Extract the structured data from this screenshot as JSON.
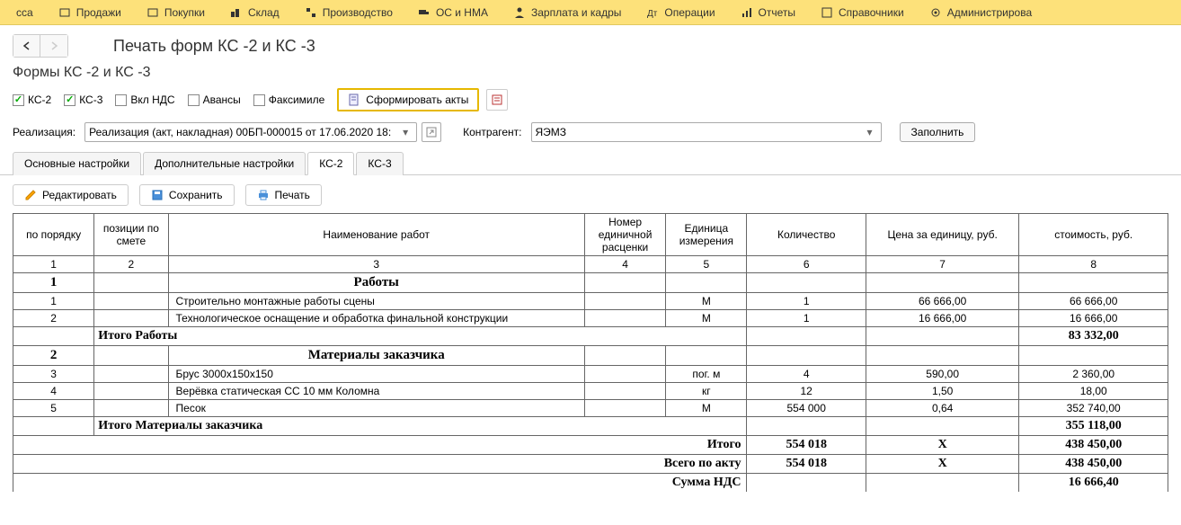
{
  "topmenu": {
    "items": [
      {
        "label": "сса"
      },
      {
        "label": "Продажи"
      },
      {
        "label": "Покупки"
      },
      {
        "label": "Склад"
      },
      {
        "label": "Производство"
      },
      {
        "label": "ОС и НМА"
      },
      {
        "label": "Зарплата и кадры"
      },
      {
        "label": "Операции"
      },
      {
        "label": "Отчеты"
      },
      {
        "label": "Справочники"
      },
      {
        "label": "Администрирова"
      }
    ]
  },
  "title": "Печать форм КС -2 и КС -3",
  "subtitle": "Формы КС -2 и КС -3",
  "checks": {
    "ks2": "КС-2",
    "ks3": "КС-3",
    "vklnds": "Вкл НДС",
    "avansy": "Авансы",
    "faksimile": "Факсимиле"
  },
  "generate_btn": "Сформировать акты",
  "fields": {
    "realiz_label": "Реализация:",
    "realiz_value": "Реализация (акт, накладная) 00БП-000015 от 17.06.2020 18:",
    "kontragent_label": "Контрагент:",
    "kontragent_value": "ЯЭМЗ",
    "fill_btn": "Заполнить"
  },
  "tabs": {
    "t1": "Основные настройки",
    "t2": "Дополнительные настройки",
    "t3": "КС-2",
    "t4": "КС-3"
  },
  "toolbar": {
    "edit": "Редактировать",
    "save": "Сохранить",
    "print": "Печать"
  },
  "table": {
    "headers": {
      "h1": "по порядку",
      "h2": "позиции по смете",
      "h3": "Наименование работ",
      "h4": "Номер единичной расценки",
      "h5": "Единица измерения",
      "h6": "Количество",
      "h7": "Цена за единицу, руб.",
      "h8": "стоимость, руб."
    },
    "nums": {
      "n1": "1",
      "n2": "2",
      "n3": "3",
      "n4": "4",
      "n5": "5",
      "n6": "6",
      "n7": "7",
      "n8": "8"
    },
    "sec1": {
      "num": "1",
      "title": "Работы"
    },
    "r1": {
      "n": "1",
      "name": "Строительно монтажные работы сцены",
      "unit": "М",
      "qty": "1",
      "price": "66 666,00",
      "cost": "66 666,00"
    },
    "r2": {
      "n": "2",
      "name": "Технологическое оснащение и обработка финальной конструкции",
      "unit": "М",
      "qty": "1",
      "price": "16 666,00",
      "cost": "16 666,00"
    },
    "subtot1": {
      "label": "Итого Работы",
      "val": "83 332,00"
    },
    "sec2": {
      "num": "2",
      "title": "Материалы заказчика"
    },
    "r3": {
      "n": "3",
      "name": "Брус 3000х150х150",
      "unit": "пог. м",
      "qty": "4",
      "price": "590,00",
      "cost": "2 360,00"
    },
    "r4": {
      "n": "4",
      "name": "Верёвка статическая CC 10 мм Коломна",
      "unit": "кг",
      "qty": "12",
      "price": "1,50",
      "cost": "18,00"
    },
    "r5": {
      "n": "5",
      "name": "Песок",
      "unit": "М",
      "qty": "554 000",
      "price": "0,64",
      "cost": "352 740,00"
    },
    "subtot2": {
      "label": "Итого Материалы заказчика",
      "val": "355 118,00"
    },
    "foot1": {
      "label": "Итого",
      "qty": "554 018",
      "price": "X",
      "cost": "438 450,00"
    },
    "foot2": {
      "label": "Всего по акту",
      "qty": "554 018",
      "price": "X",
      "cost": "438 450,00"
    },
    "foot3": {
      "label": "Сумма НДС",
      "cost": "16 666,40"
    }
  }
}
